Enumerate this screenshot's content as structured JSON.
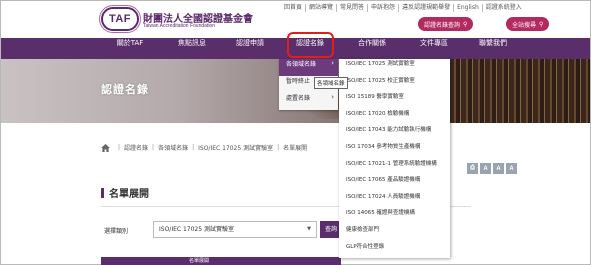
{
  "logo": {
    "mark": "TAF",
    "name_cn": "財團法人全國認證基金會",
    "name_en": "Taiwan Accreditation Foundation"
  },
  "top_links": [
    "回首頁",
    "網站導覽",
    "常見問答",
    "申訴抱怨",
    "違反認證規範舉發",
    "English",
    "認證系統登入"
  ],
  "header_buttons": {
    "registry": "認證名錄查詢",
    "site_search": "全站搜尋"
  },
  "nav": {
    "items": [
      "關於TAF",
      "焦點訊息",
      "認證申請",
      "認證名錄",
      "合作關係",
      "文件專區",
      "聯繫我們"
    ]
  },
  "banner": {
    "title": "認證名錄"
  },
  "dropdown_l1": {
    "items": [
      "各領域名錄",
      "暫時終止",
      "處置名錄"
    ],
    "active_index": 0
  },
  "tooltip": "各領域名錄",
  "dropdown_l2": {
    "items": [
      "ISO/IEC 17025 測試實驗室",
      "ISO/IEC 17025 校正實驗室",
      "ISO 15189 醫學實驗室",
      "ISO/IEC 17020 檢驗機構",
      "ISO/IEC 17043 能力試驗執行機構",
      "ISO 17034 參考物質生產機構",
      "ISO/IEC 17021-1 管理系統驗證機構",
      "ISO/IEC 17065 產品驗證機構",
      "ISO/IEC 17024 人員驗證機構",
      "ISO 14065 確證與查證機構",
      "健康檢查部門",
      "GLP符合性登錄"
    ]
  },
  "breadcrumb": {
    "items": [
      "認證名錄",
      "各領域名錄",
      "ISO/IEC 17025 測試實驗室",
      "名單展開"
    ]
  },
  "font_size_buttons": [
    "A",
    "A",
    "A"
  ],
  "section": {
    "title": "名單展開"
  },
  "filter": {
    "label": "選擇類別",
    "selected": "ISO/IEC 17025 測試實驗室",
    "query_button": "查詢"
  },
  "bottom_bar": {
    "text": "名單展開"
  },
  "colors": {
    "nav_purple": "#5a2d6b",
    "accent_magenta": "#b22a5f",
    "highlight_red": "#e01e1e"
  }
}
